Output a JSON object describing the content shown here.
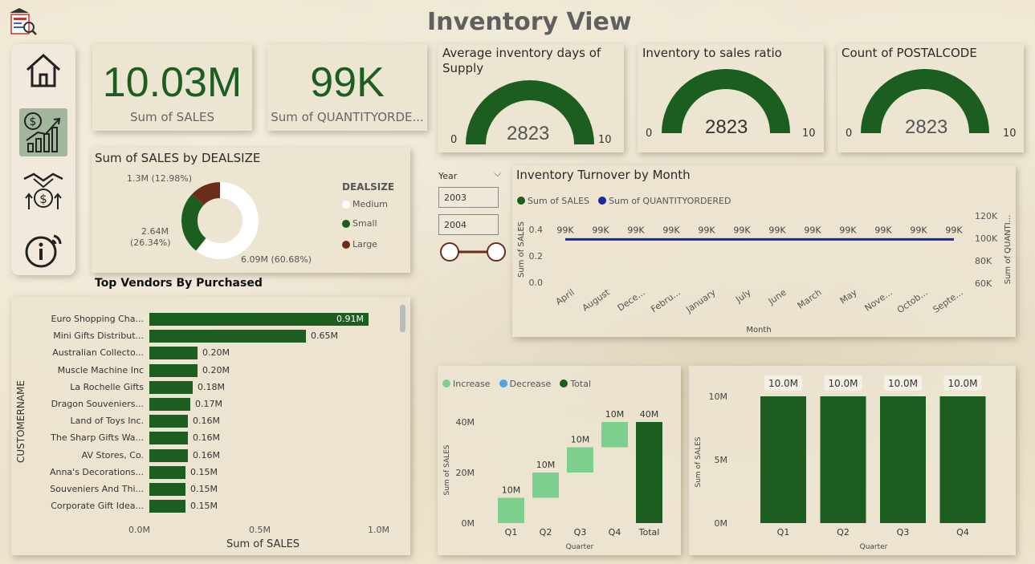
{
  "page_title": "Inventory View",
  "nav": {
    "items": [
      {
        "name": "home-icon"
      },
      {
        "name": "sales-growth-icon",
        "active": true
      },
      {
        "name": "handshake-money-icon"
      },
      {
        "name": "info-icon"
      }
    ]
  },
  "kpis": [
    {
      "value": "10.03M",
      "label": "Sum of SALES"
    },
    {
      "value": "99K",
      "label": "Sum of QUANTITYORDE..."
    }
  ],
  "gauges": [
    {
      "title": "Average inventory days of Supply",
      "value": "2823",
      "min": "0",
      "max": "10"
    },
    {
      "title": "Inventory to sales ratio",
      "value": "2823",
      "min": "0",
      "max": "10"
    },
    {
      "title": "Count of POSTALCODE",
      "value": "2823",
      "min": "0",
      "max": "10"
    }
  ],
  "donut": {
    "title": "Sum of SALES by DEALSIZE",
    "legend_title": "DEALSIZE",
    "labels": {
      "large": "1.3M (12.98%)",
      "small_a": "2.64M",
      "small_b": "(26.34%)",
      "medium": "6.09M (60.68%)"
    }
  },
  "slicer": {
    "field": "Year",
    "start": "2003",
    "end": "2004"
  },
  "turnover": {
    "title": "Inventory Turnover by Month",
    "legend": [
      "Sum of SALES",
      "Sum of QUANTITYORDERED"
    ],
    "y_left_label": "Sum of SALES",
    "y_right_label": "Sum of QUANTI...",
    "x_label": "Month",
    "y_left_ticks": [
      "0.4",
      "0.2",
      "0.0"
    ],
    "y_right_ticks": [
      "120K",
      "100K",
      "80K",
      "60K"
    ],
    "point_label": "99K",
    "months": [
      "April",
      "August",
      "Dece...",
      "Febru...",
      "January",
      "July",
      "June",
      "March",
      "May",
      "Nove...",
      "Octob...",
      "Septe..."
    ]
  },
  "vendors": {
    "title": "Top Vendors By Purchased",
    "y_label": "CUSTOMERNAME",
    "x_label": "Sum of SALES",
    "x_ticks": [
      "0.0M",
      "0.5M",
      "1.0M"
    ],
    "rows": [
      {
        "name": "Euro Shopping Cha...",
        "label": "0.91M"
      },
      {
        "name": "Mini Gifts Distribut...",
        "label": "0.65M"
      },
      {
        "name": "Australian Collecto...",
        "label": "0.20M"
      },
      {
        "name": "Muscle Machine Inc",
        "label": "0.20M"
      },
      {
        "name": "La Rochelle Gifts",
        "label": "0.18M"
      },
      {
        "name": "Dragon Souveniers...",
        "label": "0.17M"
      },
      {
        "name": "Land of Toys Inc.",
        "label": "0.16M"
      },
      {
        "name": "The Sharp Gifts Wa...",
        "label": "0.16M"
      },
      {
        "name": "AV Stores, Co.",
        "label": "0.16M"
      },
      {
        "name": "Anna's Decorations...",
        "label": "0.15M"
      },
      {
        "name": "Souveniers And Thi...",
        "label": "0.15M"
      },
      {
        "name": "Corporate Gift Idea...",
        "label": "0.15M"
      }
    ]
  },
  "waterfall": {
    "legend": [
      "Increase",
      "Decrease",
      "Total"
    ],
    "y_label": "Sum of SALES",
    "x_label": "Quarter",
    "y_ticks": [
      "40M",
      "20M",
      "0M"
    ]
  },
  "quarter_bars": {
    "y_label": "Sum of SALES",
    "x_label": "Quarter",
    "y_ticks": [
      "10M",
      "5M",
      "0M"
    ]
  },
  "colors": {
    "dark_green": "#1b5e20",
    "light_green": "#7ccf8c",
    "decrease_blue": "#4fa3e0",
    "large_brown": "#6b2d1a",
    "navy_line": "#1a2a9a"
  },
  "chart_data": [
    {
      "type": "pie",
      "title": "Sum of SALES by DEALSIZE",
      "categories": [
        "Medium",
        "Small",
        "Large"
      ],
      "values": [
        6.09,
        2.64,
        1.3
      ],
      "unit": "M"
    },
    {
      "type": "bar",
      "title": "Top Vendors By Purchased",
      "orientation": "horizontal",
      "categories": [
        "Euro Shopping Cha...",
        "Mini Gifts Distribut...",
        "Australian Collecto...",
        "Muscle Machine Inc",
        "La Rochelle Gifts",
        "Dragon Souveniers...",
        "Land of Toys Inc.",
        "The Sharp Gifts Wa...",
        "AV Stores, Co.",
        "Anna's Decorations...",
        "Souveniers And Thi...",
        "Corporate Gift Idea..."
      ],
      "values": [
        0.91,
        0.65,
        0.2,
        0.2,
        0.18,
        0.17,
        0.16,
        0.16,
        0.16,
        0.15,
        0.15,
        0.15
      ],
      "xlabel": "Sum of SALES",
      "ylabel": "CUSTOMERNAME",
      "xlim": [
        0,
        1.0
      ]
    },
    {
      "type": "line",
      "title": "Inventory Turnover by Month",
      "x": [
        "April",
        "August",
        "Dece...",
        "Febru...",
        "January",
        "July",
        "June",
        "March",
        "May",
        "Nove...",
        "Octob...",
        "Septe..."
      ],
      "series": [
        {
          "name": "Sum of QUANTITYORDERED",
          "values": [
            99000,
            99000,
            99000,
            99000,
            99000,
            99000,
            99000,
            99000,
            99000,
            99000,
            99000,
            99000
          ]
        }
      ],
      "y_right_lim": [
        60000,
        120000
      ],
      "y_left_lim": [
        0,
        0.4
      ]
    },
    {
      "type": "bar",
      "title": "",
      "subtype": "waterfall",
      "categories": [
        "Q1",
        "Q2",
        "Q3",
        "Q4",
        "Total"
      ],
      "values": [
        10,
        10,
        10,
        10,
        40
      ],
      "labels": [
        "10M",
        "10M",
        "10M",
        "10M",
        "40M"
      ],
      "ylim": [
        0,
        40
      ]
    },
    {
      "type": "bar",
      "title": "",
      "categories": [
        "Q1",
        "Q2",
        "Q3",
        "Q4"
      ],
      "values": [
        10.0,
        10.0,
        10.0,
        10.0
      ],
      "labels": [
        "10.0M",
        "10.0M",
        "10.0M",
        "10.0M"
      ],
      "ylim": [
        0,
        10
      ]
    }
  ]
}
